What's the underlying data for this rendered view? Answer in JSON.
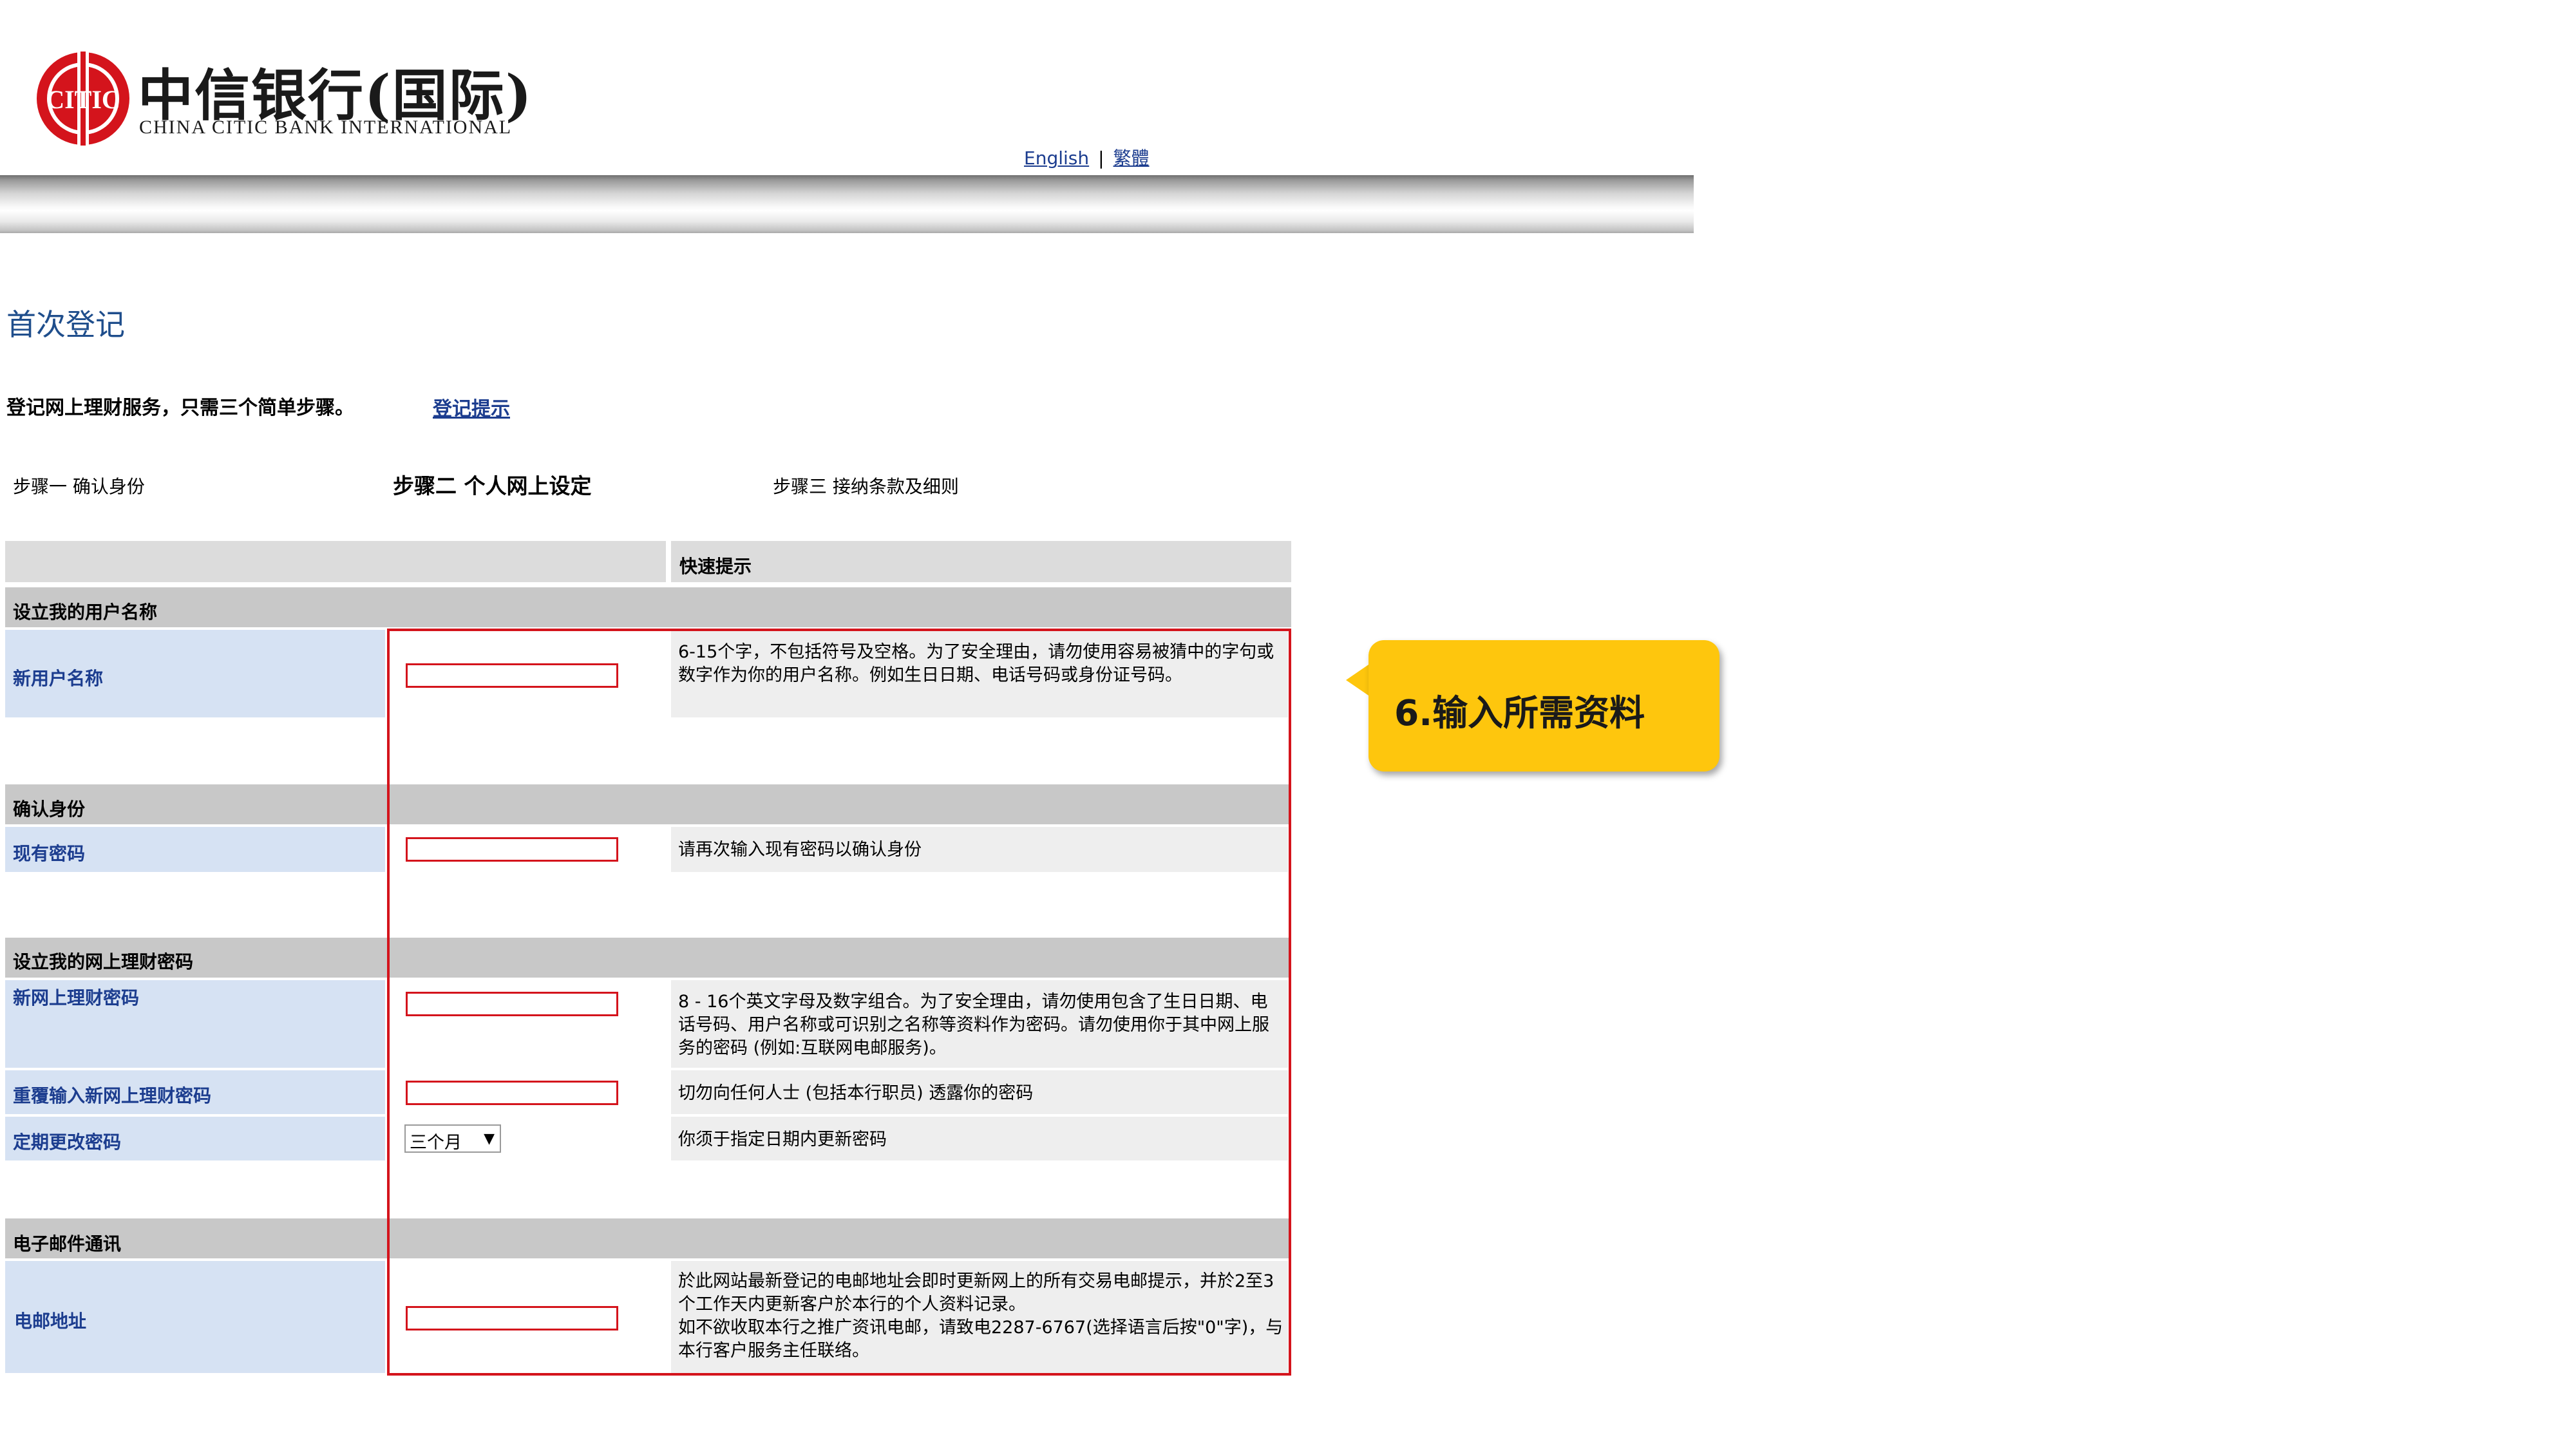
{
  "logo": {
    "name_cn": "中信银行(国际)",
    "name_en": "CHINA CITIC BANK INTERNATIONAL",
    "mark_text": "CITIC",
    "brand_color": "#d4141c"
  },
  "language_links": {
    "english": "English",
    "separator": "|",
    "traditional": "繁體"
  },
  "page_title": "首次登记",
  "intro": {
    "text": "登记网上理财服务，只需三个简单步骤。",
    "tip_link": "登记提示"
  },
  "steps": [
    "步骤一 确认身份",
    "步骤二 个人网上设定",
    "步骤三 接纳条款及细则"
  ],
  "form": {
    "quick_tip_header": "快速提示",
    "sections": [
      {
        "header": "设立我的用户名称",
        "label": "新用户名称",
        "tip": "6-15个字，不包括符号及空格。为了安全理由，请勿使用容易被猜中的字句或数字作为你的用户名称。例如生日日期、电话号码或身份证号码。"
      },
      {
        "header": "确认身份",
        "label": "现有密码",
        "tip": "请再次输入现有密码以确认身份"
      },
      {
        "header": "设立我的网上理财密码",
        "rows": [
          {
            "label": "新网上理财密码",
            "tip": "8 - 16个英文字母及数字组合。为了安全理由，请勿使用包含了生日日期、电话号码、用户名称或可识别之名称等资料作为密码。请勿使用你于其中网上服务的密码 (例如:互联网电邮服务)。"
          },
          {
            "label": "重覆输入新网上理财密码",
            "tip": "切勿向任何人士 (包括本行职员) 透露你的密码"
          },
          {
            "label": "定期更改密码",
            "select_value": "三个月",
            "tip": "你须于指定日期内更新密码"
          }
        ]
      },
      {
        "header": "电子邮件通讯",
        "label": "电邮地址",
        "tip": "於此网站最新登记的电邮地址会即时更新网上的所有交易电邮提示，并於2至3个工作天内更新客户於本行的个人资料记录。\n如不欲收取本行之推广资讯电邮，请致电2287-6767(选择语言后按\"0\"字)，与本行客户服务主任联络。"
      }
    ]
  },
  "callout": {
    "text": "6.输入所需资料",
    "color": "#fec60d"
  }
}
